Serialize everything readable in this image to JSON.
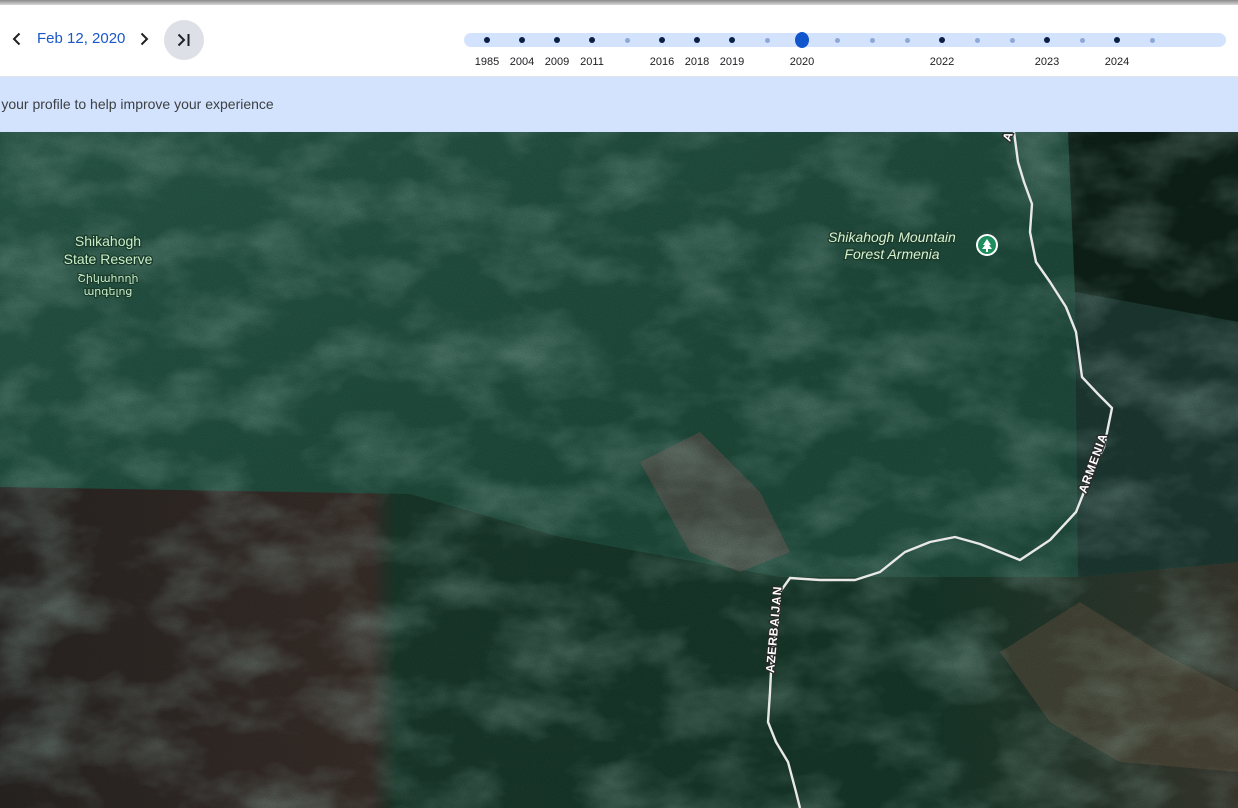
{
  "toolbar": {
    "date": "Feb 12, 2020",
    "prev_icon": "chevron-left-icon",
    "next_icon": "chevron-right-icon",
    "latest_icon": "skip-to-latest-icon"
  },
  "timeline": {
    "selected_year": "2020",
    "ticks": [
      {
        "label": "1985",
        "kind": "major"
      },
      {
        "label": "2004",
        "kind": "major"
      },
      {
        "label": "2009",
        "kind": "major"
      },
      {
        "label": "2011",
        "kind": "major"
      },
      {
        "label": "",
        "kind": "minor"
      },
      {
        "label": "2016",
        "kind": "major"
      },
      {
        "label": "2018",
        "kind": "major"
      },
      {
        "label": "2019",
        "kind": "major"
      },
      {
        "label": "",
        "kind": "minor"
      },
      {
        "label": "2020",
        "kind": "selected"
      },
      {
        "label": "",
        "kind": "minor"
      },
      {
        "label": "",
        "kind": "minor"
      },
      {
        "label": "",
        "kind": "minor"
      },
      {
        "label": "2022",
        "kind": "major"
      },
      {
        "label": "",
        "kind": "minor"
      },
      {
        "label": "",
        "kind": "minor"
      },
      {
        "label": "2023",
        "kind": "major"
      },
      {
        "label": "",
        "kind": "minor"
      },
      {
        "label": "2024",
        "kind": "major"
      },
      {
        "label": "",
        "kind": "minor"
      }
    ]
  },
  "banner": {
    "text": "ete your profile to help improve your experience"
  },
  "map": {
    "labels": {
      "reserve_line1": "Shikahogh",
      "reserve_line2": "State Reserve",
      "reserve_armenian_line1": "Շիկահողի",
      "reserve_armenian_line2": "արգելոց",
      "forest_line1": "Shikahogh Mountain",
      "forest_line2": "Forest Armenia",
      "country_armenia": "ARMENIA",
      "country_azerbaijan": "AZERBAIJAN",
      "border_top_fragment": "A"
    },
    "poi_icon": "tree-pin-icon",
    "colors": {
      "forest": "#1f4d3d",
      "forest_light": "#2e6a55",
      "dark_forest": "#0f2a20",
      "bare_ground": "#3a2f2a",
      "border_line": "#e8e8e8",
      "poi_green": "#1e8e5e"
    }
  },
  "colors": {
    "accent": "#1a57c9",
    "timeline_track": "#d3e3fd",
    "banner_bg": "#d3e3fd"
  }
}
